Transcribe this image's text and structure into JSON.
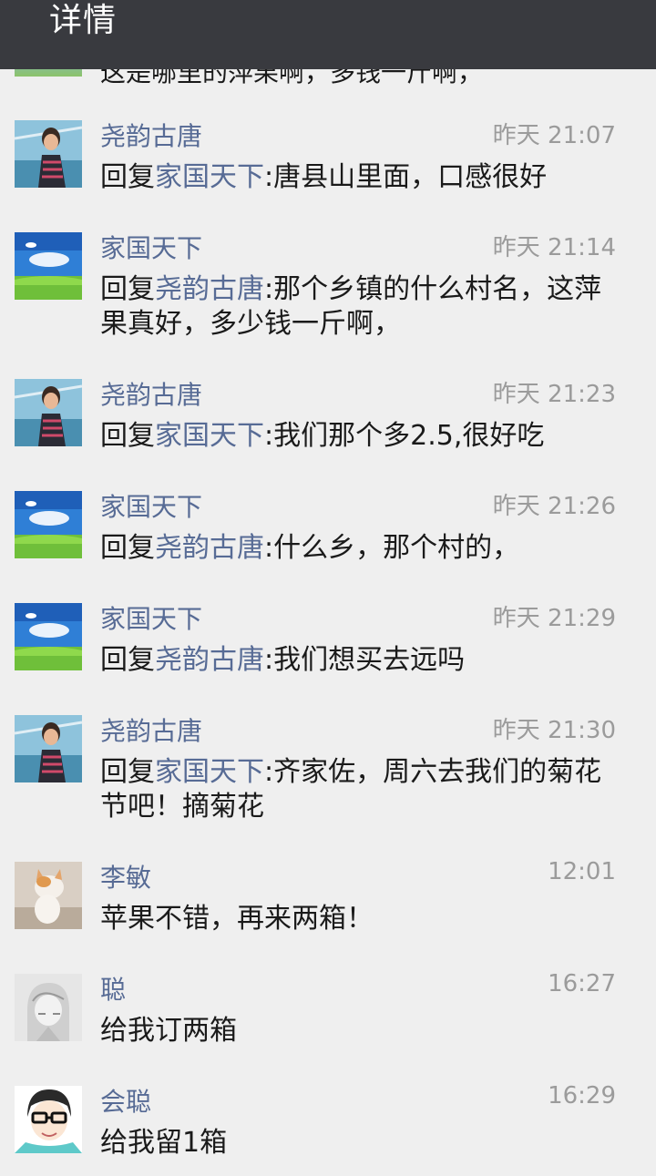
{
  "header": {
    "title": "详情"
  },
  "partial_top": {
    "text": "这是哪里的萍果啊，多钱一斤啊，"
  },
  "comments": [
    {
      "name": "尧韵古唐",
      "time": "昨天 21:07",
      "reply_prefix": "回复",
      "reply_to": "家国天下",
      "text": ":唐县山里面，口感很好",
      "avatar": "girl-photo"
    },
    {
      "name": "家国天下",
      "time": "昨天 21:14",
      "reply_prefix": "回复",
      "reply_to": "尧韵古唐",
      "text": ":那个乡镇的什么村名，这萍果真好，多少钱一斤啊，",
      "avatar": "landscape-photo"
    },
    {
      "name": "尧韵古唐",
      "time": "昨天 21:23",
      "reply_prefix": "回复",
      "reply_to": "家国天下",
      "text": ":我们那个多2.5,很好吃",
      "avatar": "girl-photo"
    },
    {
      "name": "家国天下",
      "time": "昨天 21:26",
      "reply_prefix": "回复",
      "reply_to": "尧韵古唐",
      "text": ":什么乡，那个村的，",
      "avatar": "landscape-photo"
    },
    {
      "name": "家国天下",
      "time": "昨天 21:29",
      "reply_prefix": "回复",
      "reply_to": "尧韵古唐",
      "text": ":我们想买去远吗",
      "avatar": "landscape-photo"
    },
    {
      "name": "尧韵古唐",
      "time": "昨天 21:30",
      "reply_prefix": "回复",
      "reply_to": "家国天下",
      "text": ":齐家佐，周六去我们的菊花节吧！摘菊花",
      "avatar": "girl-photo"
    },
    {
      "name": "李敏",
      "time": "12:01",
      "reply_prefix": "",
      "reply_to": "",
      "text": "苹果不错，再来两箱！",
      "avatar": "cat-photo"
    },
    {
      "name": "聪",
      "time": "16:27",
      "reply_prefix": "",
      "reply_to": "",
      "text": "给我订两箱",
      "avatar": "sketch-drawing"
    },
    {
      "name": "会聪",
      "time": "16:29",
      "reply_prefix": "",
      "reply_to": "",
      "text": "给我留1箱",
      "avatar": "cartoon-glasses"
    }
  ]
}
